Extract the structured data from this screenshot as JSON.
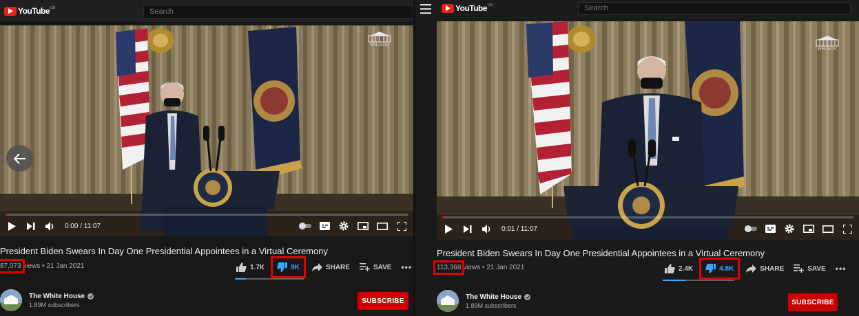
{
  "panels": [
    {
      "id": "left",
      "brand": "YouTube",
      "region": "GB",
      "search_placeholder": "Search",
      "watermark": "WH.GOV",
      "time": "0:00 / 11:07",
      "title": "President Biden Swears In Day One Presidential Appointees in a Virtual Ceremony",
      "views": "87,073",
      "views_suffix": " views • 21 Jan 2021",
      "like_count": "1.7K",
      "dislike_count": "9K",
      "share_label": "SHARE",
      "save_label": "SAVE",
      "more_label": "•••",
      "like_ratio": 0.16,
      "playback_progress": 0.0,
      "channel_name": "The White House",
      "subscribers": "1.89M subscribers",
      "subscribe_label": "SUBSCRIBE"
    },
    {
      "id": "right",
      "brand": "YouTube",
      "region": "GB",
      "search_placeholder": "Search",
      "watermark": "WH.GOV",
      "time": "0:01 / 11:07",
      "title": "President Biden Swears In Day One Presidential Appointees in a Virtual Ceremony",
      "views": "113,368",
      "views_suffix": " views • 21 Jan 2021",
      "like_count": "2.4K",
      "dislike_count": "4.8K",
      "share_label": "SHARE",
      "save_label": "SAVE",
      "more_label": "•••",
      "like_ratio": 0.33,
      "playback_progress": 0.0015,
      "channel_name": "The White House",
      "subscribers": "1.89M subscribers",
      "subscribe_label": "SUBSCRIBE"
    }
  ],
  "colors": {
    "highlight_box": "#e50000",
    "dislike_blue": "#3ea6ff",
    "subscribe_red": "#cc0000",
    "youtube_red": "#e62117"
  }
}
